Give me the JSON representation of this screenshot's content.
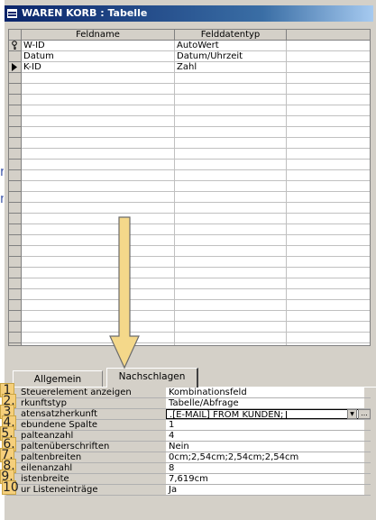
{
  "window": {
    "title": "WAREN KORB : Tabelle"
  },
  "grid": {
    "col_fieldname": "Feldname",
    "col_datatype": "Felddatentyp",
    "rows": [
      {
        "name": "W-ID",
        "type": "AutoWert",
        "marker": "key-icon"
      },
      {
        "name": "Datum",
        "type": "Datum/Uhrzeit",
        "marker": ""
      },
      {
        "name": "K-ID",
        "type": "Zahl",
        "marker": "current-row-icon"
      }
    ],
    "empty_rows": 26
  },
  "tabs": {
    "general": "Allgemein",
    "lookup": "Nachschlagen"
  },
  "properties": [
    {
      "num": "1",
      "label": "Steuerelement anzeigen",
      "value": "Kombinationsfeld"
    },
    {
      "num": "2.",
      "label": "rkunftstyp",
      "value": "Tabelle/Abfrage"
    },
    {
      "num": "3",
      "label": "atensatzherkunft",
      "value": ".[E-MAIL] FROM KUNDEN;"
    },
    {
      "num": "4.",
      "label": "ebundene Spalte",
      "value": "1"
    },
    {
      "num": "5.",
      "label": "palteanzahl",
      "value": "4"
    },
    {
      "num": "6.",
      "label": "paltenüberschriften",
      "value": "Nein"
    },
    {
      "num": "7.",
      "label": "paltenbreiten",
      "value": "0cm;2,54cm;2,54cm;2,54cm"
    },
    {
      "num": "8.",
      "label": "eilenanzahl",
      "value": "8"
    },
    {
      "num": "9.",
      "label": "istenbreite",
      "value": "7,619cm"
    },
    {
      "num": "10",
      "label": "ur Listeneinträge",
      "value": "Ja"
    }
  ],
  "colors": {
    "titlebar": "#0a246a",
    "highlight_num": "#f5cf7b",
    "arrow": "#f4d88a"
  },
  "left_fragments": [
    "r",
    "n"
  ]
}
